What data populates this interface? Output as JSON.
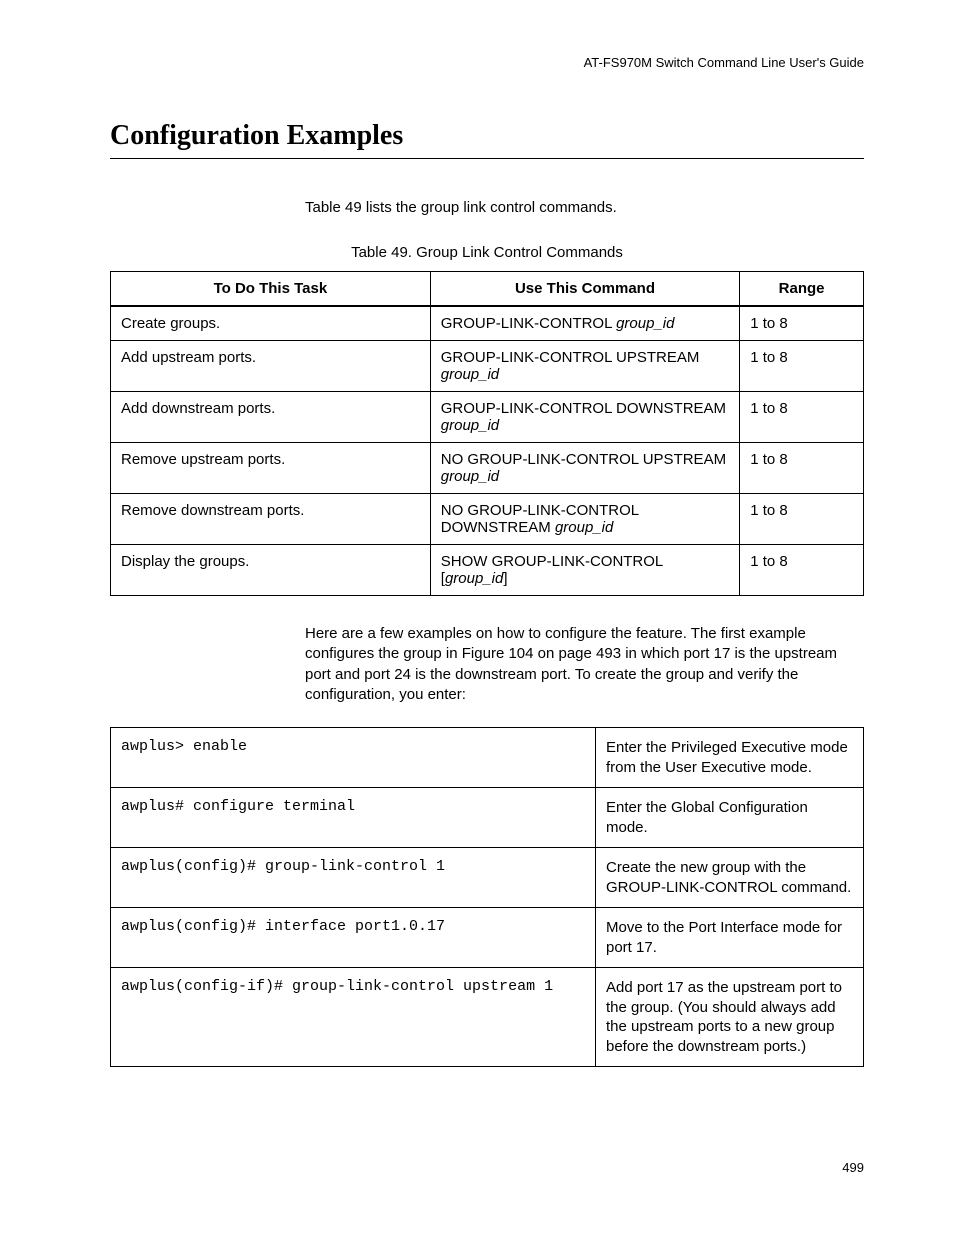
{
  "header": {
    "guide_title": "AT-FS970M Switch Command Line User's Guide"
  },
  "section": {
    "title": "Configuration Examples"
  },
  "intro": "Table 49 lists the group link control commands.",
  "table49": {
    "caption": "Table 49. Group Link Control Commands",
    "headers": {
      "task": "To Do This Task",
      "command": "Use This Command",
      "range": "Range"
    },
    "rows": [
      {
        "task": "Create groups.",
        "cmd_prefix": "GROUP-LINK-CONTROL ",
        "cmd_param": "group_id",
        "cmd_suffix": "",
        "range": "1 to 8"
      },
      {
        "task": "Add upstream ports.",
        "cmd_prefix": "GROUP-LINK-CONTROL UPSTREAM ",
        "cmd_param": "group_id",
        "cmd_suffix": "",
        "range": "1 to 8"
      },
      {
        "task": "Add downstream ports.",
        "cmd_prefix": "GROUP-LINK-CONTROL DOWNSTREAM ",
        "cmd_param": "group_id",
        "cmd_suffix": "",
        "range": "1 to 8"
      },
      {
        "task": "Remove upstream ports.",
        "cmd_prefix": "NO GROUP-LINK-CONTROL UPSTREAM ",
        "cmd_param": "group_id",
        "cmd_suffix": "",
        "range": "1 to 8"
      },
      {
        "task": "Remove downstream ports.",
        "cmd_prefix": "NO GROUP-LINK-CONTROL DOWNSTREAM ",
        "cmd_param": "group_id",
        "cmd_suffix": "",
        "range": "1 to 8"
      },
      {
        "task": "Display the groups.",
        "cmd_prefix": "SHOW GROUP-LINK-CONTROL [",
        "cmd_param": "group_id",
        "cmd_suffix": "]",
        "range": "1 to 8"
      }
    ]
  },
  "para1": "Here are a few examples on how to configure the feature. The first example configures the group in Figure 104 on page 493 in which port 17 is the upstream port and port 24 is the downstream port. To create the group and verify the configuration, you enter:",
  "steps": [
    {
      "code": "awplus> enable",
      "desc": "Enter the Privileged Executive mode from the User Executive mode."
    },
    {
      "code": "awplus# configure terminal",
      "desc": "Enter the Global Configuration mode."
    },
    {
      "code": "awplus(config)# group-link-control 1",
      "desc": "Create the new group with the GROUP-LINK-CONTROL command."
    },
    {
      "code": "awplus(config)# interface port1.0.17",
      "desc": "Move to the Port Interface mode for port 17."
    },
    {
      "code": "awplus(config-if)# group-link-control upstream 1",
      "desc": "Add port 17 as the upstream port to the group. (You should always add the upstream ports to a new group before the downstream ports.)"
    }
  ],
  "page_number": "499"
}
